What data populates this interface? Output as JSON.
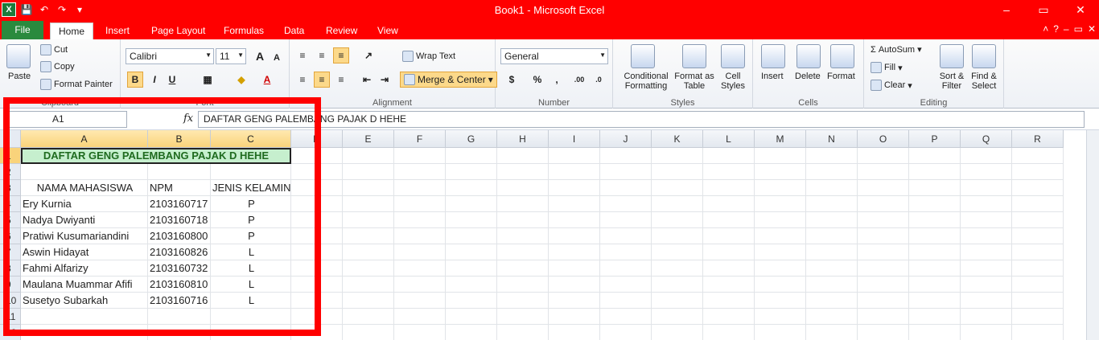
{
  "app": {
    "title": "Book1  -  Microsoft Excel",
    "colors": {
      "titlebar": "#ff0000",
      "file_tab": "#2a8a3e",
      "highlight": "#f9d37b",
      "merged_fill": "#c6efce",
      "merged_text": "#1f6b1f"
    }
  },
  "qat": {
    "icons": [
      "excel-logo-icon",
      "save-icon",
      "undo-icon",
      "redo-icon",
      "customize-icon"
    ],
    "excel_glyph": "X"
  },
  "window": {
    "minimize": "–",
    "restore": "▭",
    "close": "✕"
  },
  "tabs": [
    "File",
    "Home",
    "Insert",
    "Page Layout",
    "Formulas",
    "Data",
    "Review",
    "View"
  ],
  "help": {
    "chevron": "˄",
    "help": "?",
    "min": "–",
    "restore": "▭",
    "close": "✕"
  },
  "ribbon": {
    "clipboard": {
      "paste": "Paste",
      "cut": "Cut",
      "copy": "Copy",
      "format_painter": "Format Painter",
      "label": "Clipboard"
    },
    "font": {
      "name": "Calibri",
      "size": "11",
      "grow": "A",
      "shrink": "A",
      "bold": "B",
      "italic": "I",
      "underline": "U",
      "label": "Font"
    },
    "alignment": {
      "wrap": "Wrap Text",
      "merge": "Merge & Center",
      "label": "Alignment"
    },
    "number": {
      "format": "General",
      "currency": "$",
      "percent": "%",
      "comma": ",",
      "inc": ".00",
      "dec": ".0",
      "label": "Number"
    },
    "styles": {
      "cond": "Conditional Formatting",
      "table": "Format as Table",
      "cell": "Cell Styles",
      "label": "Styles"
    },
    "cells": {
      "insert": "Insert",
      "delete": "Delete",
      "format": "Format",
      "label": "Cells"
    },
    "editing": {
      "autosum": "AutoSum",
      "fill": "Fill",
      "clear": "Clear",
      "sort": "Sort & Filter",
      "find": "Find & Select",
      "label": "Editing"
    }
  },
  "formula": {
    "name_box": "A1",
    "fx": "fx",
    "content": "DAFTAR GENG PALEMBANG PAJAK D HEHE"
  },
  "columns": [
    "A",
    "B",
    "C",
    "D",
    "E",
    "F",
    "G",
    "H",
    "I",
    "J",
    "K",
    "L",
    "M",
    "N",
    "O",
    "P",
    "Q",
    "R"
  ],
  "rows": [
    "1",
    "2",
    "3",
    "4",
    "5",
    "6",
    "7",
    "8",
    "9",
    "10",
    "11",
    "12"
  ],
  "sheet": {
    "title": "DAFTAR GENG PALEMBANG PAJAK D HEHE",
    "headers": [
      "NAMA MAHASISWA",
      "NPM",
      "JENIS KELAMIN"
    ],
    "data": [
      [
        "Ery Kurnia",
        "2103160717",
        "P"
      ],
      [
        "Nadya Dwiyanti",
        "2103160718",
        "P"
      ],
      [
        "Pratiwi Kusumariandini",
        "2103160800",
        "P"
      ],
      [
        "Aswin Hidayat",
        "2103160826",
        "L"
      ],
      [
        "Fahmi Alfarizy",
        "2103160732",
        "L"
      ],
      [
        "Maulana Muammar Afifi",
        "2103160810",
        "L"
      ],
      [
        "Susetyo Subarkah",
        "2103160716",
        "L"
      ]
    ]
  }
}
